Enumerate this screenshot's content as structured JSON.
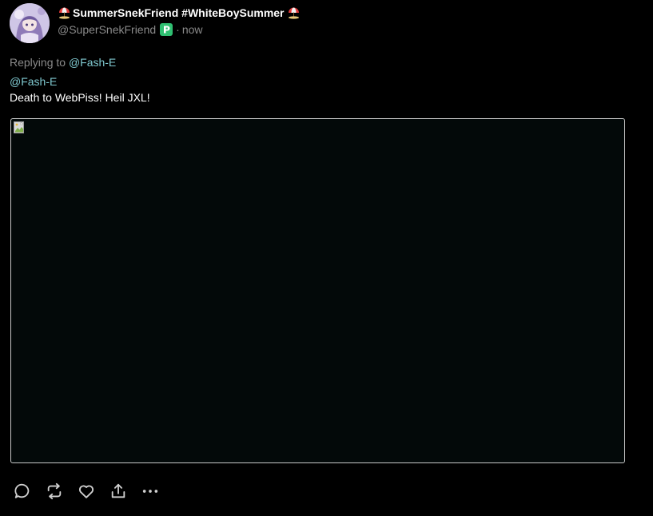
{
  "post": {
    "display_name": "SummerSnekFriend #WhiteBoySummer",
    "handle": "@SuperSnekFriend",
    "timestamp_separator": "·",
    "timestamp": "now",
    "replying_to_label": "Replying to",
    "replying_to_handle": "@Fash-E",
    "mention": "@Fash-E",
    "body_text": "Death to WebPiss! Heil JXL!"
  },
  "icons": {
    "name_emoji": "beach-umbrella-icon",
    "badge": "platform-badge-icon",
    "media": "broken-image-icon",
    "actions": [
      "reply-icon",
      "repost-icon",
      "like-icon",
      "share-icon",
      "more-icon"
    ]
  },
  "colors": {
    "background": "#000000",
    "link": "#7fc8cf",
    "muted_text": "#8a8a8a",
    "media_background": "#030909",
    "badge_green": "#2fbf71"
  }
}
